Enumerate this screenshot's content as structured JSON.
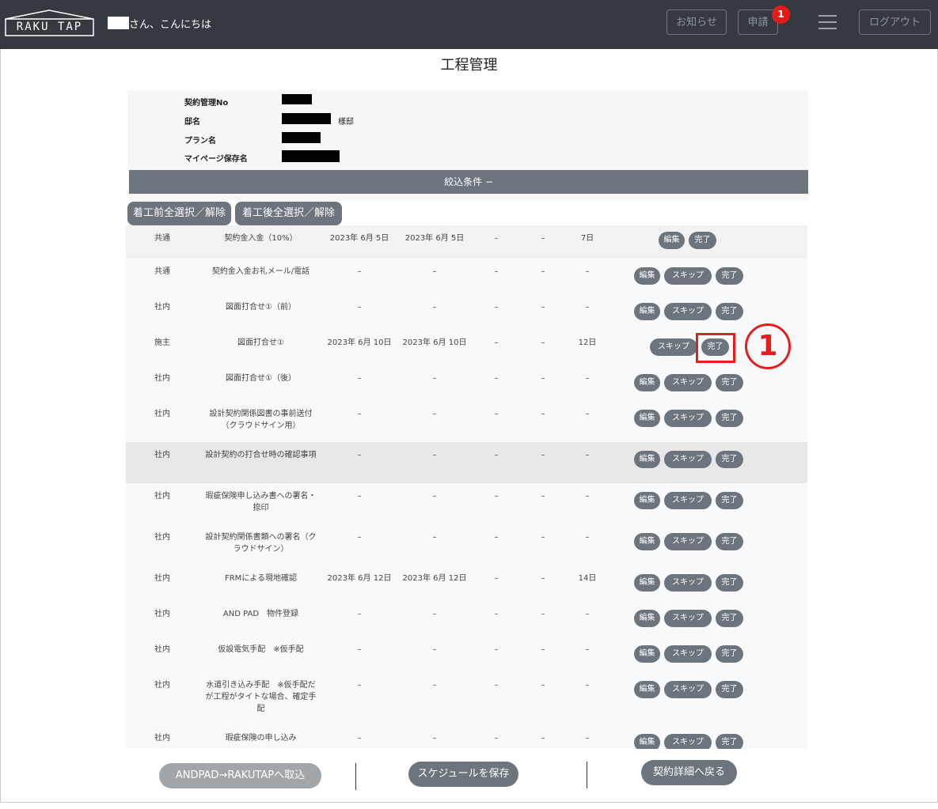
{
  "header": {
    "logo_text": "RAKU TAP",
    "greeting": "さん、こんにちは",
    "notice_label": "お知らせ",
    "apply_label": "申請",
    "apply_badge": "1",
    "logout_label": "ログアウト"
  },
  "page": {
    "title": "工程管理"
  },
  "info": {
    "contract_no_label": "契約管理No",
    "name_label": "邸名",
    "name_suffix": "様邸",
    "plan_label": "プラン名",
    "mypage_label": "マイページ保存名"
  },
  "filter": {
    "label": "絞込条件 −"
  },
  "select_buttons": {
    "before": "着工前全選択／解除",
    "after": "着工後全選択／解除"
  },
  "action_labels": {
    "edit": "編集",
    "skip": "スキップ",
    "done": "完了"
  },
  "rows": [
    {
      "type": "共通",
      "name": "契約金入金（10%）",
      "date1": "2023年 6月 5日",
      "date2": "2023年 6月 5日",
      "col_a": "–",
      "col_b": "–",
      "days": "7日"
    },
    {
      "type": "共通",
      "name": "契約金入金お礼メール/電話",
      "date1": "–",
      "date2": "–",
      "col_a": "–",
      "col_b": "–",
      "days": "–"
    },
    {
      "type": "社内",
      "name": "図面打合せ①（前）",
      "date1": "–",
      "date2": "–",
      "col_a": "–",
      "col_b": "–",
      "days": "–"
    },
    {
      "type": "施主",
      "name": "図面打合せ①",
      "date1": "2023年 6月 10日",
      "date2": "2023年 6月 10日",
      "col_a": "–",
      "col_b": "–",
      "days": "12日"
    },
    {
      "type": "社内",
      "name": "図面打合せ①（後）",
      "date1": "–",
      "date2": "–",
      "col_a": "–",
      "col_b": "–",
      "days": "–"
    },
    {
      "type": "社内",
      "name": "設計契約関係図書の事前送付（クラウドサイン用）",
      "date1": "–",
      "date2": "–",
      "col_a": "–",
      "col_b": "–",
      "days": "–"
    },
    {
      "type": "社内",
      "name": "設計契約の打合せ時の確認事項",
      "date1": "–",
      "date2": "–",
      "col_a": "–",
      "col_b": "–",
      "days": "–"
    },
    {
      "type": "社内",
      "name": "瑕疵保険申し込み書への署名・捺印",
      "date1": "–",
      "date2": "–",
      "col_a": "–",
      "col_b": "–",
      "days": "–"
    },
    {
      "type": "社内",
      "name": "設計契約関係書類への署名（クラウドサイン）",
      "date1": "–",
      "date2": "–",
      "col_a": "–",
      "col_b": "–",
      "days": "–"
    },
    {
      "type": "社内",
      "name": "FRMによる現地確認",
      "date1": "2023年 6月 12日",
      "date2": "2023年 6月 12日",
      "col_a": "–",
      "col_b": "–",
      "days": "14日"
    },
    {
      "type": "社内",
      "name": "AND PAD　物件登録",
      "date1": "–",
      "date2": "–",
      "col_a": "–",
      "col_b": "–",
      "days": "–"
    },
    {
      "type": "社内",
      "name": "仮設電気手配　※仮手配",
      "date1": "–",
      "date2": "–",
      "col_a": "–",
      "col_b": "–",
      "days": "–"
    },
    {
      "type": "社内",
      "name": "水道引き込み手配　※仮手配だが工程がタイトな場合、確定手配",
      "date1": "–",
      "date2": "–",
      "col_a": "–",
      "col_b": "–",
      "days": "–"
    },
    {
      "type": "社内",
      "name": "瑕疵保険の申し込み",
      "date1": "–",
      "date2": "–",
      "col_a": "–",
      "col_b": "–",
      "days": "–"
    }
  ],
  "annotation": {
    "marker": "1"
  },
  "footer": {
    "import_label": "ANDPAD→RAKUTAPへ取込",
    "save_label": "スケジュールを保存",
    "back_label": "契約詳細へ戻る"
  }
}
